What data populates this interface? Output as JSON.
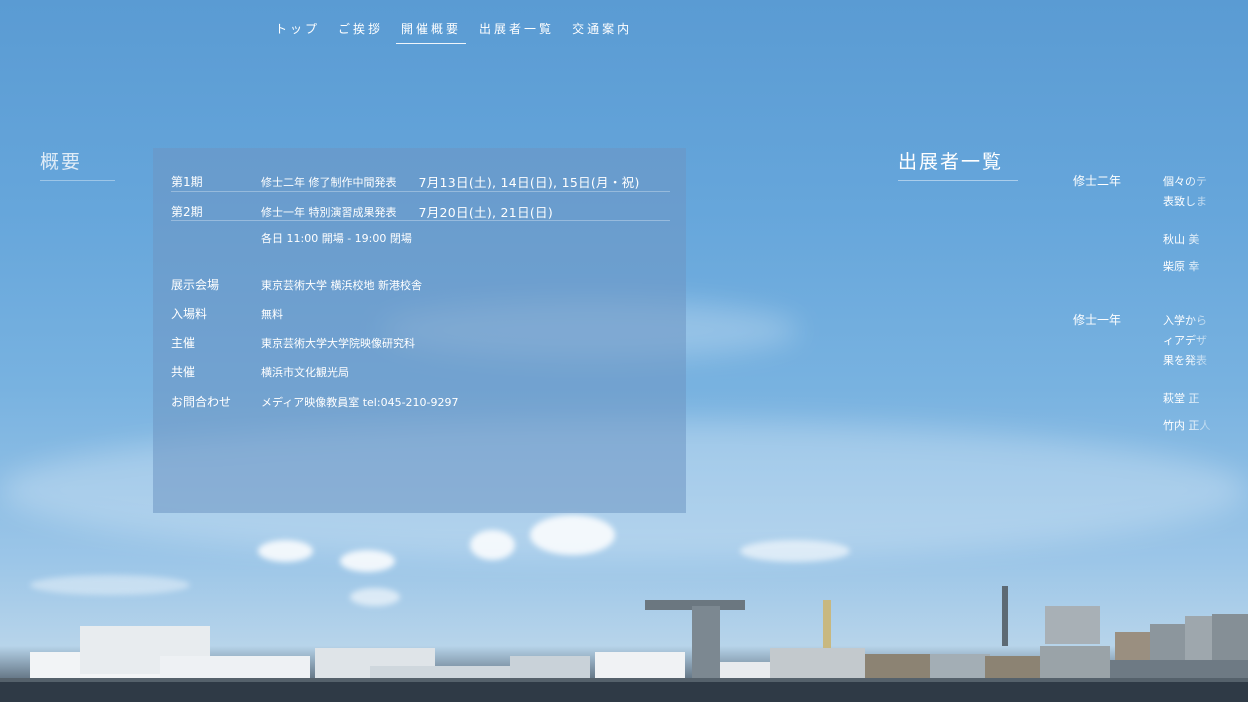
{
  "nav": {
    "items": [
      {
        "label": "トップ"
      },
      {
        "label": "ご挨拶"
      },
      {
        "label": "開催概要"
      },
      {
        "label": "出展者一覧"
      },
      {
        "label": "交通案内"
      }
    ]
  },
  "overview": {
    "title": "概要"
  },
  "exhibitors": {
    "title": "出展者一覧",
    "grade2": {
      "label": "修士二年",
      "text1": "個々のテ",
      "text2": "表致しま",
      "name1": "秋山 美",
      "name2": "柴原 幸"
    },
    "grade1": {
      "label": "修士一年",
      "text1": "入学から",
      "text2": "ィアデザ",
      "text3": "果を発表",
      "name1": "萩堂 正",
      "name2": "竹内 正人"
    }
  },
  "panel": {
    "period1": {
      "label": "第1期",
      "desc": "修士二年 修了制作中間発表",
      "date": "7月13日(土), 14日(日), 15日(月・祝)"
    },
    "period2": {
      "label": "第2期",
      "desc": "修士一年 特別演習成果発表",
      "date": "7月20日(土), 21日(日)"
    },
    "hours": "各日 11:00 開場 - 19:00 閉場",
    "venue": {
      "label": "展示会場",
      "value": "東京芸術大学 横浜校地 新港校舎"
    },
    "fee": {
      "label": "入場料",
      "value": "無料"
    },
    "host": {
      "label": "主催",
      "value": "東京芸術大学大学院映像研究科"
    },
    "cohost": {
      "label": "共催",
      "value": "横浜市文化観光局"
    },
    "contact": {
      "label": "お問合わせ",
      "value": "メディア映像教員室 tel:045-210-9297"
    }
  }
}
